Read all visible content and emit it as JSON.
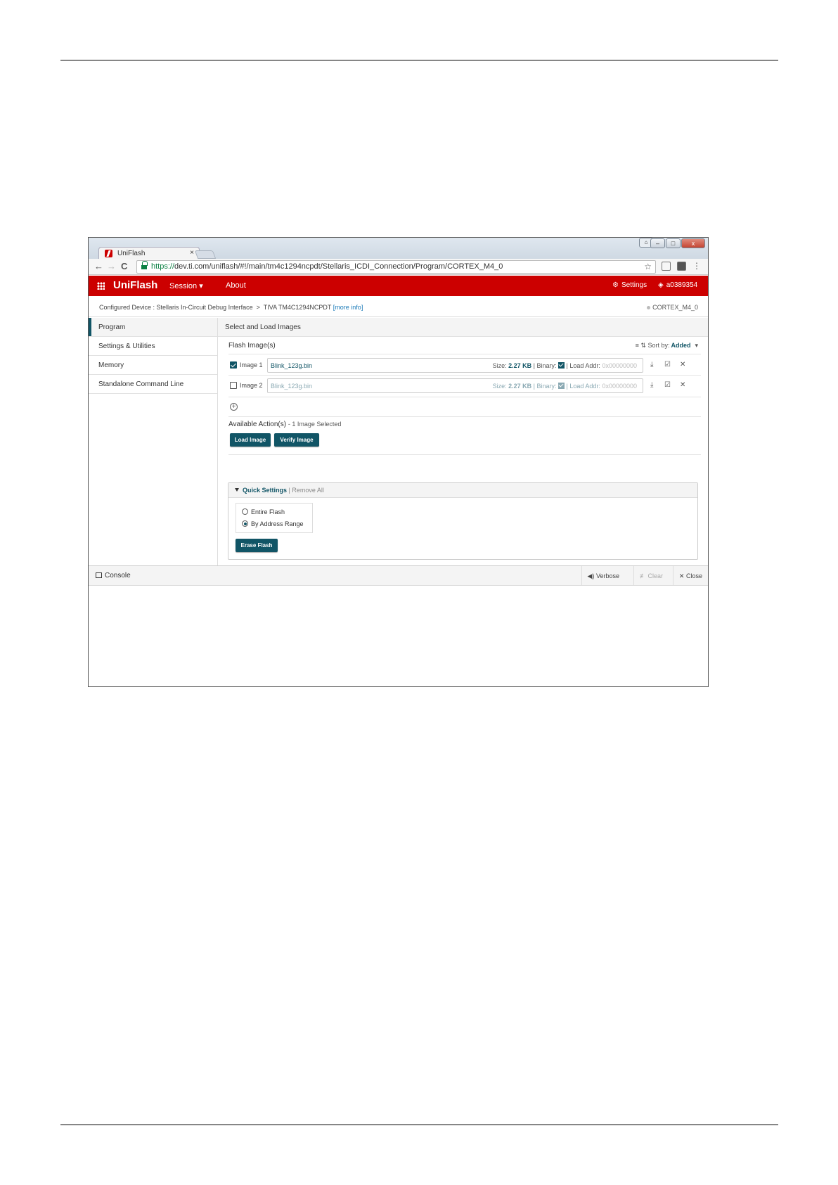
{
  "browser": {
    "tab_title": "UniFlash",
    "tab_close": "×",
    "url_scheme": "https://",
    "url_rest": "dev.ti.com/uniflash/#!/main/tm4c1294ncpdt/Stellaris_ICDI_Connection/Program/CORTEX_M4_0",
    "back": "←",
    "forward": "→",
    "reload": "C",
    "star": "☆",
    "menu": "⋮",
    "minimize": "–",
    "maximize": "□",
    "close": "x"
  },
  "app": {
    "brand": "UniFlash",
    "menu_session": "Session ▾",
    "menu_about": "About",
    "settings": "Settings",
    "user": "a0389354",
    "accent_color": "#cc0000",
    "primary_color": "#115566"
  },
  "device": {
    "configured_label": "Configured Device : Stellaris In-Circuit Debug Interface",
    "separator": ">",
    "target": "TIVA TM4C1294NCPDT",
    "more_info": "[more info]",
    "core": "CORTEX_M4_0"
  },
  "sidebar": {
    "items": [
      {
        "label": "Program"
      },
      {
        "label": "Settings & Utilities"
      },
      {
        "label": "Memory"
      },
      {
        "label": "Standalone Command Line"
      }
    ]
  },
  "main": {
    "title": "Select and Load Images",
    "flash_header": "Flash Image(s)",
    "sort_label": "Sort by:",
    "sort_value": "Added",
    "images": [
      {
        "label": "Image 1",
        "checked": true,
        "filename": "Blink_123g.bin",
        "size_label": "Size:",
        "size": "2.27 KB",
        "binary_label": "| Binary:",
        "load_addr_label": "| Load Addr:",
        "load_addr_placeholder": "0x00000000"
      },
      {
        "label": "Image 2",
        "checked": false,
        "filename": "Blink_123g.bin",
        "size_label": "Size:",
        "size": "2.27 KB",
        "binary_label": "| Binary:",
        "load_addr_label": "| Load Addr:",
        "load_addr_placeholder": "0x00000000"
      }
    ],
    "available_actions": "Available Action(s)",
    "selection_status": "- 1 Image Selected",
    "load_button": "Load Image",
    "verify_button": "Verify Image"
  },
  "quick_settings": {
    "title": "Quick Settings",
    "remove_all": "| Remove All",
    "option_entire": "Entire Flash",
    "option_range": "By Address Range",
    "selected_option": "By Address Range",
    "erase_button": "Erase Flash"
  },
  "console": {
    "title": "Console",
    "verbose": "Verbose",
    "clear": "Clear",
    "close": "Close"
  }
}
